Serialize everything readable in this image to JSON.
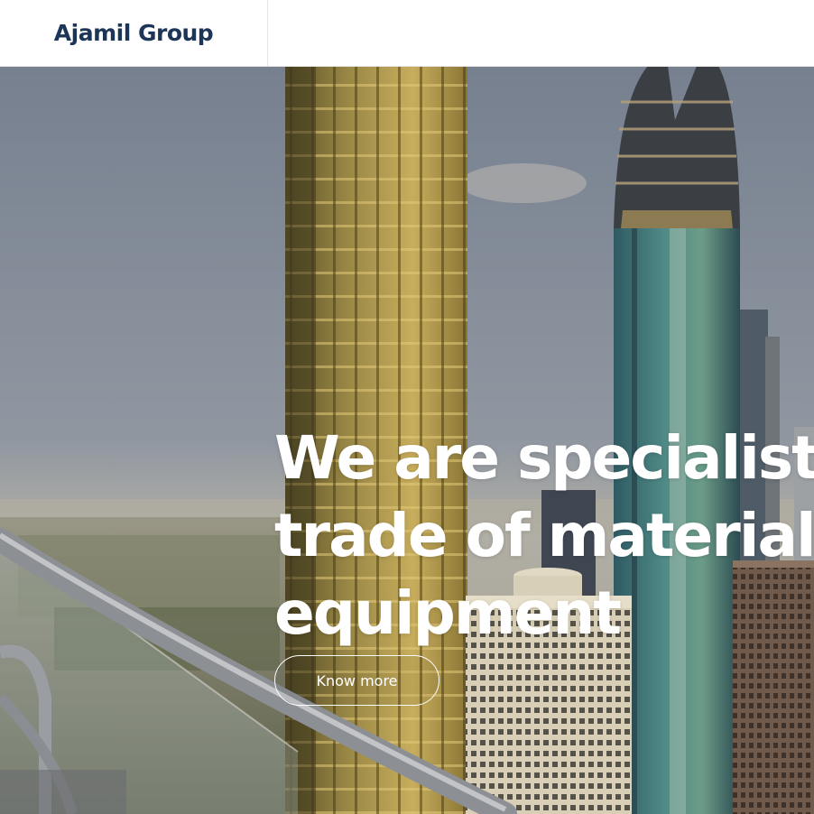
{
  "header": {
    "logo_text": "Ajamil Group"
  },
  "hero": {
    "title_lines": [
      "We are specialists in the",
      "trade of materials and",
      "equipment"
    ],
    "cta_label": "Know more"
  },
  "colors": {
    "brand": "#1d3557",
    "hero_text": "#ffffff"
  }
}
